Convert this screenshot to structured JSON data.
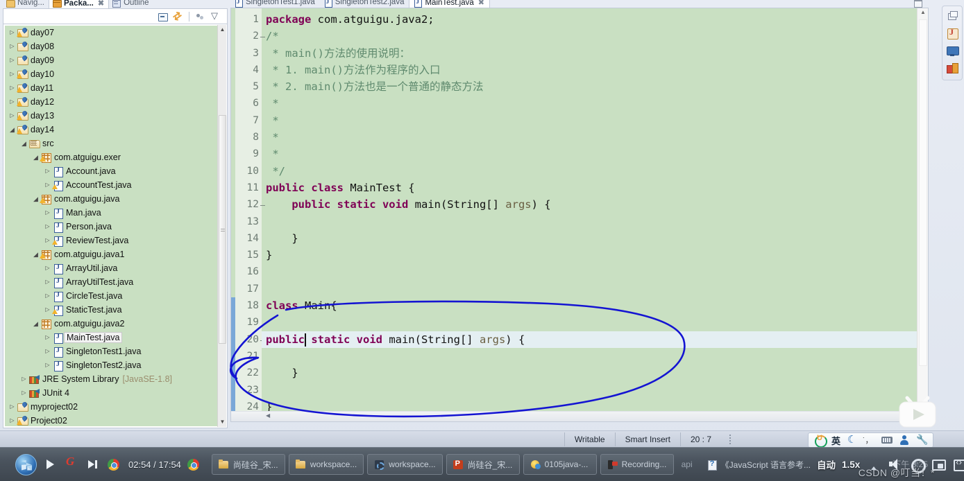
{
  "ide": {
    "left_view": {
      "tabs": [
        {
          "label": "Navig...",
          "icon": "navigator-icon",
          "active": false
        },
        {
          "label": "Packa...",
          "icon": "package-explorer-icon",
          "active": true,
          "close": "✖"
        },
        {
          "label": "Outline",
          "icon": "outline-icon",
          "active": false
        }
      ],
      "toolbar": [
        {
          "name": "collapse-all-icon",
          "title": "Collapse All"
        },
        {
          "name": "link-with-editor-icon",
          "title": "Link with Editor"
        },
        {
          "name": "view-menu-dots-icon",
          "title": "View Menu"
        },
        {
          "name": "chevron-down-icon",
          "title": "Menu"
        }
      ],
      "tree": [
        {
          "indent": 0,
          "twist": "closed",
          "icon": "project-warn-icon",
          "label": "day07"
        },
        {
          "indent": 0,
          "twist": "closed",
          "icon": "project-icon",
          "label": "day08"
        },
        {
          "indent": 0,
          "twist": "closed",
          "icon": "project-icon",
          "label": "day09"
        },
        {
          "indent": 0,
          "twist": "closed",
          "icon": "project-warn-icon",
          "label": "day10"
        },
        {
          "indent": 0,
          "twist": "closed",
          "icon": "project-warn-icon",
          "label": "day11"
        },
        {
          "indent": 0,
          "twist": "closed",
          "icon": "project-warn-icon",
          "label": "day12"
        },
        {
          "indent": 0,
          "twist": "closed",
          "icon": "project-warn-icon",
          "label": "day13"
        },
        {
          "indent": 0,
          "twist": "open",
          "icon": "project-warn-icon",
          "label": "day14"
        },
        {
          "indent": 1,
          "twist": "open",
          "icon": "source-folder-icon",
          "label": "src"
        },
        {
          "indent": 2,
          "twist": "open",
          "icon": "package-warn-icon",
          "label": "com.atguigu.exer"
        },
        {
          "indent": 3,
          "twist": "closed",
          "icon": "java-file-icon",
          "label": "Account.java"
        },
        {
          "indent": 3,
          "twist": "closed",
          "icon": "java-file-warn-icon",
          "label": "AccountTest.java"
        },
        {
          "indent": 2,
          "twist": "open",
          "icon": "package-warn-icon",
          "label": "com.atguigu.java"
        },
        {
          "indent": 3,
          "twist": "closed",
          "icon": "java-file-icon",
          "label": "Man.java"
        },
        {
          "indent": 3,
          "twist": "closed",
          "icon": "java-file-icon",
          "label": "Person.java"
        },
        {
          "indent": 3,
          "twist": "closed",
          "icon": "java-file-warn-icon",
          "label": "ReviewTest.java"
        },
        {
          "indent": 2,
          "twist": "open",
          "icon": "package-warn-icon",
          "label": "com.atguigu.java1"
        },
        {
          "indent": 3,
          "twist": "closed",
          "icon": "java-file-icon",
          "label": "ArrayUtil.java"
        },
        {
          "indent": 3,
          "twist": "closed",
          "icon": "java-file-icon",
          "label": "ArrayUtilTest.java"
        },
        {
          "indent": 3,
          "twist": "closed",
          "icon": "java-file-icon",
          "label": "CircleTest.java"
        },
        {
          "indent": 3,
          "twist": "closed",
          "icon": "java-file-warn-icon",
          "label": "StaticTest.java"
        },
        {
          "indent": 2,
          "twist": "open",
          "icon": "package-icon",
          "label": "com.atguigu.java2"
        },
        {
          "indent": 3,
          "twist": "closed",
          "icon": "java-file-icon",
          "label": "MainTest.java",
          "selected": true
        },
        {
          "indent": 3,
          "twist": "closed",
          "icon": "java-file-icon",
          "label": "SingletonTest1.java"
        },
        {
          "indent": 3,
          "twist": "closed",
          "icon": "java-file-icon",
          "label": "SingletonTest2.java"
        },
        {
          "indent": 1,
          "twist": "closed",
          "icon": "library-icon",
          "label": "JRE System Library",
          "sub": "[JavaSE-1.8]"
        },
        {
          "indent": 1,
          "twist": "closed",
          "icon": "library-icon",
          "label": "JUnit 4"
        },
        {
          "indent": 0,
          "twist": "closed",
          "icon": "project-icon",
          "label": "myproject02"
        },
        {
          "indent": 0,
          "twist": "closed",
          "icon": "project-warn-icon",
          "label": "Project02"
        }
      ]
    },
    "editor": {
      "tabs": [
        {
          "label": "SingletonTest1.java",
          "active": false
        },
        {
          "label": "SingletonTest2.java",
          "active": false
        },
        {
          "label": "MainTest.java",
          "active": true,
          "close": "✖"
        }
      ],
      "lines": [
        {
          "n": 1,
          "fold": false,
          "hl": false,
          "tokens": [
            {
              "t": "kw",
              "v": "package"
            },
            {
              "t": "plain",
              "v": " com.atguigu.java2;"
            }
          ]
        },
        {
          "n": 2,
          "fold": true,
          "hl": false,
          "tokens": [
            {
              "t": "cmt",
              "v": "/*"
            }
          ]
        },
        {
          "n": 3,
          "fold": false,
          "hl": false,
          "tokens": [
            {
              "t": "cmt",
              "v": " * main()方法的使用说明："
            }
          ]
        },
        {
          "n": 4,
          "fold": false,
          "hl": false,
          "tokens": [
            {
              "t": "cmt",
              "v": " * 1. main()方法作为程序的入口"
            }
          ]
        },
        {
          "n": 5,
          "fold": false,
          "hl": false,
          "tokens": [
            {
              "t": "cmt",
              "v": " * 2. main()方法也是一个普通的静态方法"
            }
          ]
        },
        {
          "n": 6,
          "fold": false,
          "hl": false,
          "tokens": [
            {
              "t": "cmt",
              "v": " *"
            }
          ]
        },
        {
          "n": 7,
          "fold": false,
          "hl": false,
          "tokens": [
            {
              "t": "cmt",
              "v": " *"
            }
          ]
        },
        {
          "n": 8,
          "fold": false,
          "hl": false,
          "tokens": [
            {
              "t": "cmt",
              "v": " *"
            }
          ]
        },
        {
          "n": 9,
          "fold": false,
          "hl": false,
          "tokens": [
            {
              "t": "cmt",
              "v": " *"
            }
          ]
        },
        {
          "n": 10,
          "fold": false,
          "hl": false,
          "tokens": [
            {
              "t": "cmt",
              "v": " */"
            }
          ]
        },
        {
          "n": 11,
          "fold": false,
          "hl": false,
          "tokens": [
            {
              "t": "kw",
              "v": "public class"
            },
            {
              "t": "plain",
              "v": " MainTest {"
            }
          ]
        },
        {
          "n": 12,
          "fold": true,
          "hl": false,
          "tokens": [
            {
              "t": "plain",
              "v": "    "
            },
            {
              "t": "kw",
              "v": "public static void"
            },
            {
              "t": "plain",
              "v": " main(String[] "
            },
            {
              "t": "param",
              "v": "args"
            },
            {
              "t": "plain",
              "v": ") {"
            }
          ]
        },
        {
          "n": 13,
          "fold": false,
          "hl": false,
          "tokens": [
            {
              "t": "plain",
              "v": ""
            }
          ]
        },
        {
          "n": 14,
          "fold": false,
          "hl": false,
          "tokens": [
            {
              "t": "plain",
              "v": "    }"
            }
          ]
        },
        {
          "n": 15,
          "fold": false,
          "hl": false,
          "tokens": [
            {
              "t": "plain",
              "v": "}"
            }
          ]
        },
        {
          "n": 16,
          "fold": false,
          "hl": false,
          "tokens": [
            {
              "t": "plain",
              "v": ""
            }
          ]
        },
        {
          "n": 17,
          "fold": false,
          "hl": false,
          "tokens": [
            {
              "t": "plain",
              "v": ""
            }
          ]
        },
        {
          "n": 18,
          "fold": false,
          "hl": false,
          "tokens": [
            {
              "t": "kw",
              "v": "class"
            },
            {
              "t": "plain",
              "v": " Main{"
            }
          ]
        },
        {
          "n": 19,
          "fold": false,
          "hl": false,
          "tokens": [
            {
              "t": "plain",
              "v": ""
            }
          ]
        },
        {
          "n": 20,
          "fold": true,
          "hl": true,
          "tokens": [
            {
              "t": "kw",
              "v": "public"
            },
            {
              "t": "kw",
              "v": " static void"
            },
            {
              "t": "plain",
              "v": " main(String[] "
            },
            {
              "t": "param",
              "v": "args"
            },
            {
              "t": "plain",
              "v": ") {"
            }
          ]
        },
        {
          "n": 21,
          "fold": false,
          "hl": false,
          "tokens": [
            {
              "t": "plain",
              "v": ""
            }
          ]
        },
        {
          "n": 22,
          "fold": false,
          "hl": false,
          "tokens": [
            {
              "t": "plain",
              "v": "    }"
            }
          ]
        },
        {
          "n": 23,
          "fold": false,
          "hl": false,
          "tokens": [
            {
              "t": "plain",
              "v": ""
            }
          ]
        },
        {
          "n": 24,
          "fold": false,
          "hl": false,
          "tokens": [
            {
              "t": "plain",
              "v": "}"
            }
          ]
        }
      ],
      "colors": {
        "background": "#c9e0c2",
        "keyword": "#7f0055",
        "comment": "#5f8a6e",
        "parameter": "#6a5f42",
        "current_line": "#e4eff2",
        "change_bar": "#7aa8d8",
        "annotation": "#1414d2"
      }
    },
    "perspective_bar": [
      {
        "name": "restore-perspective-icon"
      },
      {
        "name": "java-perspective-icon"
      },
      {
        "name": "monitor-perspective-icon"
      },
      {
        "name": "debug-perspective-icon"
      }
    ],
    "status_bar": {
      "writable": "Writable",
      "insert_mode": "Smart Insert",
      "position": "20 : 7"
    }
  },
  "ime_toolbar": {
    "items": [
      {
        "name": "sogou-logo-icon",
        "label": ""
      },
      {
        "name": "input-mode-label",
        "label": "英"
      },
      {
        "name": "moon-icon",
        "label": ""
      },
      {
        "name": "punctuation-icon",
        "label": ""
      },
      {
        "name": "soft-keyboard-icon",
        "label": ""
      },
      {
        "name": "user-account-icon",
        "label": ""
      },
      {
        "name": "settings-wrench-icon",
        "label": ""
      }
    ]
  },
  "player": {
    "time": "02:54 / 17:54",
    "speed": "1.5x",
    "quality": "自动",
    "clock": "下午 3:25",
    "watermark": "CSDN @叮当！*",
    "controls_left": [
      {
        "name": "windows-start-orb",
        "label": ""
      },
      {
        "name": "play-button",
        "label": ""
      },
      {
        "name": "gamers-icon",
        "label": ""
      },
      {
        "name": "next-track-button",
        "label": ""
      },
      {
        "name": "chrome-icon",
        "label": ""
      }
    ],
    "controls_right": [
      {
        "name": "quality-label",
        "label": "自动"
      },
      {
        "name": "speed-label",
        "label": "1.5x"
      },
      {
        "name": "volume-icon",
        "label": ""
      },
      {
        "name": "settings-gear-icon",
        "label": ""
      },
      {
        "name": "picture-in-picture-icon",
        "label": ""
      },
      {
        "name": "widescreen-icon",
        "label": ""
      },
      {
        "name": "fullscreen-icon",
        "label": ""
      },
      {
        "name": "danmaku-icon",
        "label": ""
      }
    ],
    "taskbar": [
      {
        "name": "taskbar-item-folder-1",
        "icon": "folder-icon",
        "label": "尚硅谷_宋..."
      },
      {
        "name": "taskbar-item-folder-2",
        "icon": "folder-icon",
        "label": "workspace..."
      },
      {
        "name": "taskbar-item-eclipse",
        "icon": "eclipse-workspace-icon",
        "label": "workspace..."
      },
      {
        "name": "taskbar-item-ppt",
        "icon": "powerpoint-icon",
        "label": "尚硅谷_宋..."
      },
      {
        "name": "taskbar-item-qq",
        "icon": "qq-icon",
        "label": "0105java-..."
      },
      {
        "name": "taskbar-item-recording",
        "icon": "recording-icon",
        "label": "Recording..."
      },
      {
        "name": "taskbar-item-api",
        "icon": "api-doc-icon",
        "label": "api"
      },
      {
        "name": "taskbar-item-jsref",
        "icon": "api-doc-icon",
        "label": "《JavaScript 语言参考..."
      }
    ]
  }
}
